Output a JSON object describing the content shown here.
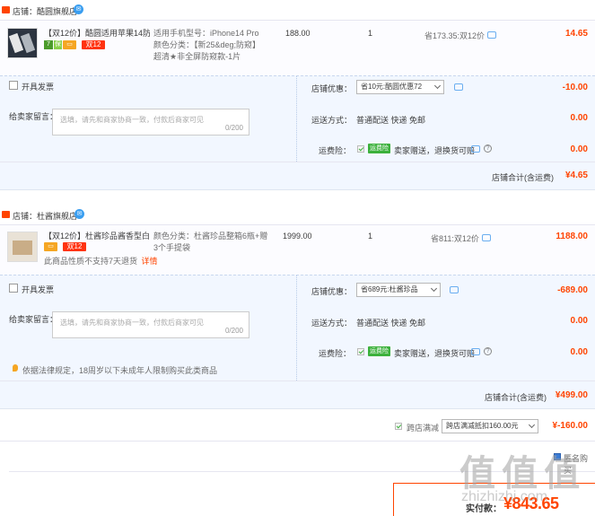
{
  "shops": [
    {
      "name": "店铺：酷圆旗舰店",
      "item": {
        "title_line1": "【双12价】酷圆适用苹果14防…",
        "badge_7": "7",
        "badge_g": "保",
        "badge_double12": "双12",
        "sku_line1": "适用手机型号：iPhone14 Pro",
        "sku_line2": "颜色分类：【新25&deg;防窥】",
        "sku_line3": "超清★非全屏防窥款-1片",
        "price": "188.00",
        "qty": "1",
        "save": "省173.35:双12价",
        "subtotal": "14.65"
      },
      "free_ship": "开具发票",
      "note_label": "给卖家留言：",
      "note_placeholder": "选填，请先和商家协商一致，付款后商家可见",
      "note_count": "0/200",
      "coupon_label": "店铺优惠：",
      "coupon_value": "省10元:酷圆优惠72",
      "coupon_amount": "-10.00",
      "ship_label": "运送方式：",
      "ship_value": "普通配送 快递 免邮",
      "ship_amount": "0.00",
      "ins_label": "运费险：",
      "ins_badge": "运费险",
      "ins_value": "卖家赠送，退换货可赔",
      "ins_amount": "0.00",
      "total_label": "店铺合计(含运费)",
      "total_value": "¥4.65"
    },
    {
      "name": "店铺：杜酱旗舰店",
      "item": {
        "title_line1": "【双12价】杜酱珍品酱香型白…",
        "badge_double12": "双12",
        "return_note": "此商品性质不支持7天退货",
        "return_link": "详情",
        "sku_line1": "颜色分类：杜酱珍品整箱6瓶+赠",
        "sku_line2": "3个手提袋",
        "price": "1999.00",
        "qty": "1",
        "save": "省811:双12价",
        "subtotal": "1188.00"
      },
      "free_ship": "开具发票",
      "note_label": "给卖家留言：",
      "note_placeholder": "选填，请先和商家协商一致，付款后商家可见",
      "note_count": "0/200",
      "coupon_label": "店铺优惠：",
      "coupon_value": "省689元:杜酱珍品",
      "coupon_amount": "-689.00",
      "ship_label": "运送方式：",
      "ship_value": "普通配送 快递 免邮",
      "ship_amount": "0.00",
      "ins_label": "运费险：",
      "ins_badge": "运费险",
      "ins_value": "卖家赠送，退换货可赔",
      "ins_amount": "0.00",
      "law_note": "依据法律规定，18周岁以下未成年人限制购买此类商品",
      "total_label": "店铺合计(含运费)",
      "total_value": "¥499.00"
    }
  ],
  "cross": {
    "label": "跨店满减",
    "select": "跨店满减抵扣160.00元",
    "amount": "¥-160.00"
  },
  "footer": {
    "anon": "匿名购买",
    "pay_label": "实付款：",
    "pay_value": "¥843.65",
    "watermark": "值 值 值",
    "watermark_url": "zhizhizhi.com"
  },
  "colors": {
    "accent": "#ff4400",
    "panel": "#f2f7ff",
    "insurance": "#3cb13c"
  }
}
